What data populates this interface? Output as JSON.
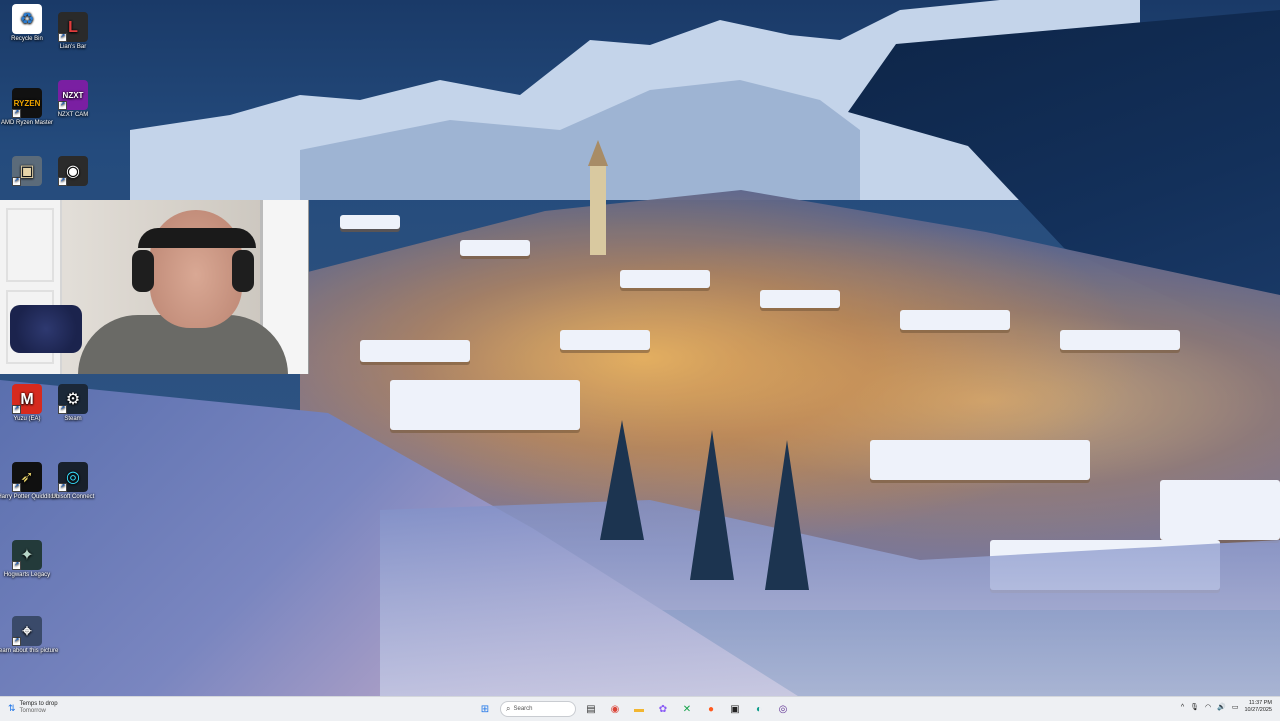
{
  "desktop_icons": [
    {
      "name": "recycle-bin-icon",
      "label": "Recycle Bin",
      "glyph": "♻",
      "bg": "#ffffff",
      "color": "#2a7cd1"
    },
    {
      "name": "lians-bar-icon",
      "label": "Lian's Bar",
      "glyph": "L",
      "bg": "#2a2a2a",
      "color": "#e03c3c"
    },
    {
      "name": "amd-ryzen-master-icon",
      "label": "AMD Ryzen Master",
      "glyph": "RYZEN",
      "bg": "#111111",
      "color": "#f0a500"
    },
    {
      "name": "nzxt-cam-icon",
      "label": "NZXT CAM",
      "glyph": "NZXT",
      "bg": "#7a1fa2",
      "color": "#ffffff"
    },
    {
      "name": "game-shortcut-icon",
      "label": "",
      "glyph": "▣",
      "bg": "#5b6b7a",
      "color": "#e6d4a8"
    },
    {
      "name": "obs-studio-icon",
      "label": "",
      "glyph": "◉",
      "bg": "#2b2b2b",
      "color": "#ffffff"
    },
    {
      "name": "mario-game-icon",
      "label": "Yuzu (EA)",
      "glyph": "M",
      "bg": "#d62a1e",
      "color": "#ffffff"
    },
    {
      "name": "steam-icon",
      "label": "Steam",
      "glyph": "⚙",
      "bg": "#1b2838",
      "color": "#ffffff"
    },
    {
      "name": "harry-potter-quidditch-icon",
      "label": "Harry Potter Quidditch",
      "glyph": "➶",
      "bg": "#101010",
      "color": "#e8d26a"
    },
    {
      "name": "ubisoft-connect-icon",
      "label": "Ubisoft Connect",
      "glyph": "◎",
      "bg": "#18202b",
      "color": "#38e0ff"
    },
    {
      "name": "hogwarts-legacy-icon",
      "label": "Hogwarts Legacy",
      "glyph": "✦",
      "bg": "#233a3a",
      "color": "#b8d6c8"
    },
    {
      "name": "learn-about-picture-icon",
      "label": "Learn about this picture",
      "glyph": "⌖",
      "bg": "#3a4a6a",
      "color": "#ffffff"
    }
  ],
  "taskbar": {
    "weather_label": "Temps to drop",
    "weather_sub": "Tomorrow",
    "search_placeholder": "Search",
    "time": "11:37 PM",
    "date": "10/27/2025",
    "pinned_apps": [
      {
        "name": "start-button",
        "glyph": "⊞",
        "color": "#1a73e8"
      },
      {
        "name": "task-view-icon",
        "glyph": "▤",
        "color": "#333333"
      },
      {
        "name": "chrome-icon",
        "glyph": "◉",
        "color": "#db4437"
      },
      {
        "name": "file-explorer-icon",
        "glyph": "▬",
        "color": "#f2b631"
      },
      {
        "name": "copilot-icon",
        "glyph": "✿",
        "color": "#8a5cf6"
      },
      {
        "name": "xbox-app-icon",
        "glyph": "✕",
        "color": "#16a34a"
      },
      {
        "name": "steelseries-icon",
        "glyph": "●",
        "color": "#ff5a1f"
      },
      {
        "name": "terminal-icon",
        "glyph": "▣",
        "color": "#222222"
      },
      {
        "name": "edge-icon",
        "glyph": "◐",
        "color": "#0f9d8a"
      },
      {
        "name": "obs-taskbar-icon",
        "glyph": "◎",
        "color": "#5c2d91"
      }
    ],
    "tray_icons": [
      {
        "name": "chevron-up-icon",
        "glyph": "^"
      },
      {
        "name": "microphone-icon",
        "glyph": "🎙"
      },
      {
        "name": "wifi-icon",
        "glyph": "◠"
      },
      {
        "name": "volume-icon",
        "glyph": "🔊"
      },
      {
        "name": "battery-icon",
        "glyph": "▭"
      }
    ]
  }
}
